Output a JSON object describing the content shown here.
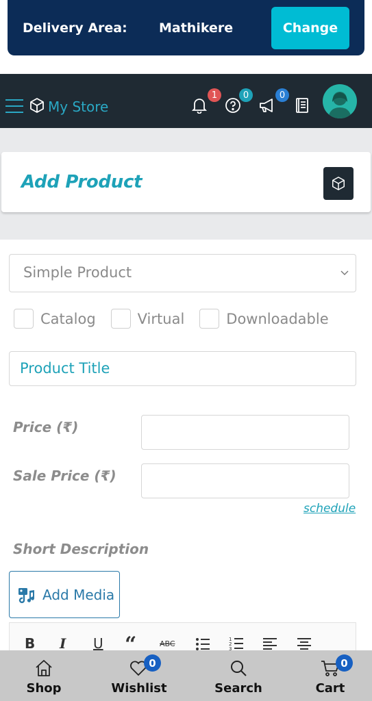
{
  "delivery": {
    "label": "Delivery Area:",
    "area": "Mathikere",
    "change_label": "Change"
  },
  "header": {
    "store_name": "My Store",
    "notifications_count": "1",
    "help_count": "0",
    "announcements_count": "0"
  },
  "card": {
    "title": "Add Product"
  },
  "form": {
    "product_type": "Simple Product",
    "checkbox_catalog": "Catalog",
    "checkbox_virtual": "Virtual",
    "checkbox_downloadable": "Downloadable",
    "title_placeholder": "Product Title",
    "price_label": "Price (₹)",
    "sale_price_label": "Sale Price (₹)",
    "schedule_label": "schedule",
    "short_description_label": "Short Description",
    "add_media_label": "Add Media"
  },
  "bottom_nav": {
    "shop": "Shop",
    "wishlist": "Wishlist",
    "wishlist_count": "0",
    "search": "Search",
    "cart": "Cart",
    "cart_count": "0"
  },
  "colors": {
    "navy": "#0c2c57",
    "cyan": "#00bcd4",
    "teal": "#1ea2b8",
    "dark": "#1f2a33"
  }
}
